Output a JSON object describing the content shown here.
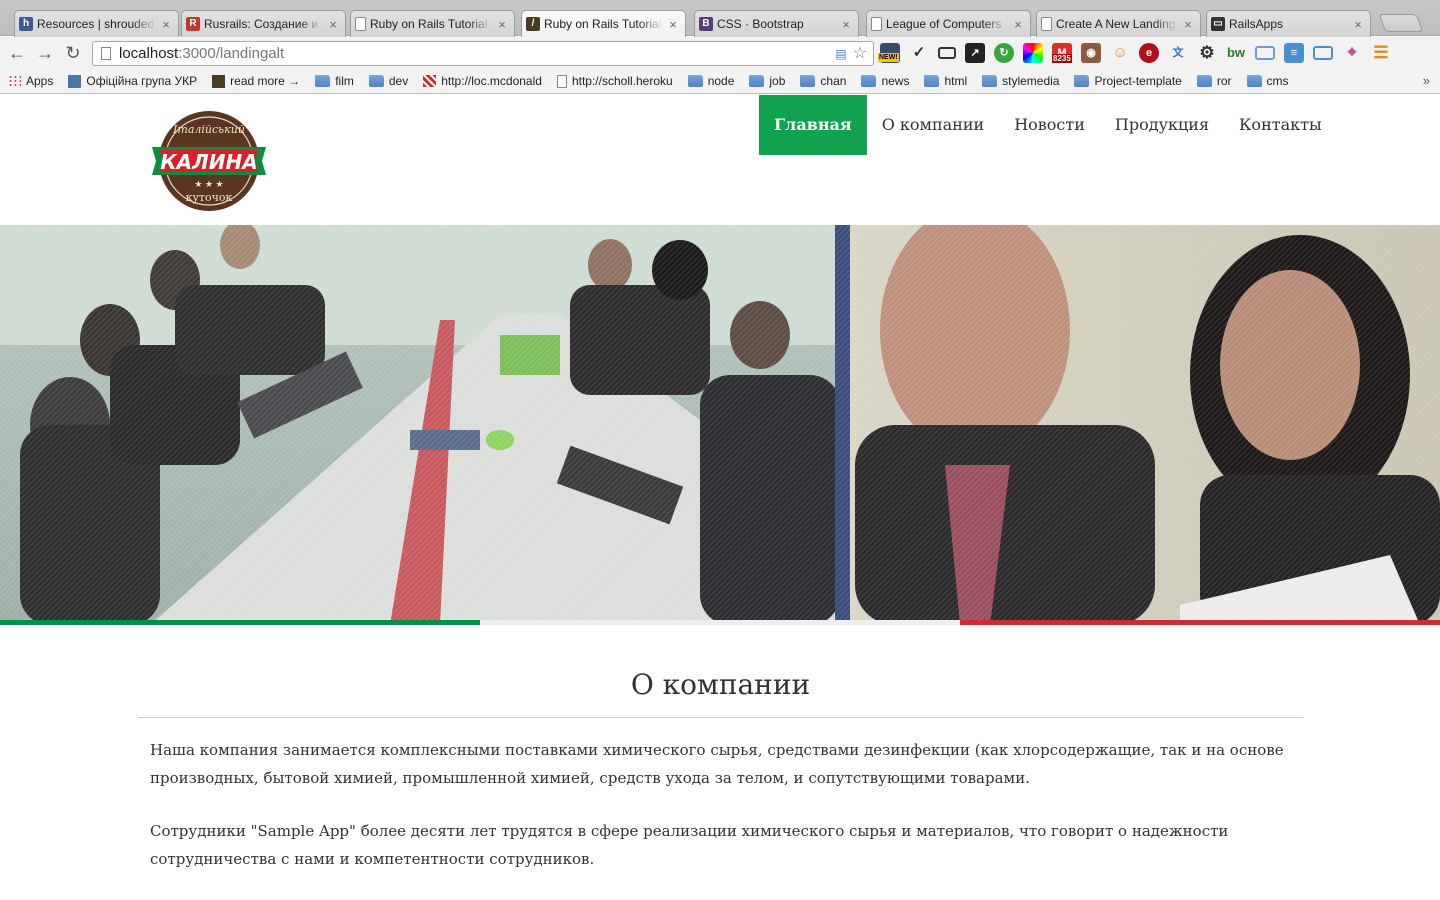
{
  "browser": {
    "tabs": [
      {
        "title": "Resources | shrouded",
        "icon": "hatena-favicon-icon",
        "color": "#3e5b99",
        "glyph": "h"
      },
      {
        "title": "Rusrails: Создание и",
        "icon": "rusrails-favicon-icon",
        "color": "#c0392b",
        "glyph": "R"
      },
      {
        "title": "Ruby on Rails Tutorial",
        "icon": "page-icon",
        "color": "",
        "glyph": ""
      },
      {
        "title": "Ruby on Rails Tutorial",
        "icon": "feather-favicon-icon",
        "color": "#4a3b22",
        "glyph": "/"
      },
      {
        "title": "CSS · Bootstrap",
        "icon": "bootstrap-favicon-icon",
        "color": "#563d7c",
        "glyph": "B"
      },
      {
        "title": "League of Computers",
        "icon": "page-icon",
        "color": "",
        "glyph": ""
      },
      {
        "title": "Create A New Landing",
        "icon": "page-icon",
        "color": "",
        "glyph": ""
      },
      {
        "title": "RailsApps",
        "icon": "railsapps-favicon-icon",
        "color": "#333333",
        "glyph": "▭"
      }
    ],
    "active_tab": 3,
    "url_host": "localhost",
    "url_path": ":3000/landingalt",
    "bookmarks": [
      {
        "label": "Apps",
        "type": "apps"
      },
      {
        "label": "Офіційна група УКР",
        "type": "vk"
      },
      {
        "label": "read more →",
        "type": "feather"
      },
      {
        "label": "film",
        "type": "folder"
      },
      {
        "label": "dev",
        "type": "folder"
      },
      {
        "label": "http://loc.mcdonald",
        "type": "gift"
      },
      {
        "label": "http://scholl.heroku",
        "type": "page"
      },
      {
        "label": "node",
        "type": "folder"
      },
      {
        "label": "job",
        "type": "folder"
      },
      {
        "label": "chan",
        "type": "folder"
      },
      {
        "label": "news",
        "type": "folder"
      },
      {
        "label": "html",
        "type": "folder"
      },
      {
        "label": "stylemedia",
        "type": "folder"
      },
      {
        "label": "Project-template",
        "type": "folder"
      },
      {
        "label": "ror",
        "type": "folder"
      },
      {
        "label": "cms",
        "type": "folder"
      }
    ],
    "bookmarks_more": "»",
    "extension_badge": "8235",
    "extension_new": "NEW!"
  },
  "site": {
    "logo": {
      "top_text": "Італійський",
      "brand": "КАЛИНА",
      "bottom_text": "куточок"
    },
    "nav": [
      {
        "label": "Главная",
        "active": true
      },
      {
        "label": "О компании",
        "active": false
      },
      {
        "label": "Новости",
        "active": false
      },
      {
        "label": "Продукция",
        "active": false
      },
      {
        "label": "Контакты",
        "active": false
      }
    ],
    "colors": {
      "accent_green": "#12a14e",
      "flag_green": "#009246",
      "flag_white": "#ffffff",
      "flag_red": "#ce2b37"
    },
    "about": {
      "title": "О компании",
      "paragraphs": [
        "Наша компания занимается комплексными поставками химического сырья, средствами дезинфекции (как хлорсодержащие, так и на основе производных, бытовой химией, промышленной химией, средств ухода за телом, и сопутствующими товарами.",
        "Сотрудники \"Sample App\" более десяти лет трудятся в сфере реализации химического сырья и материалов, что говорит о надежности сотрудничества с нами и компетентности сотрудников."
      ]
    }
  }
}
